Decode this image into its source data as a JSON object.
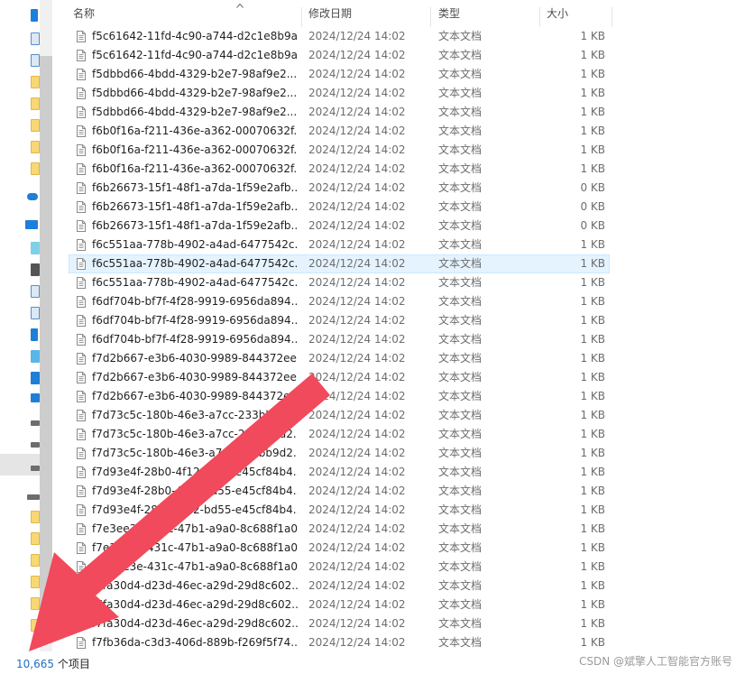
{
  "columns": {
    "name": "名称",
    "date": "修改日期",
    "type": "类型",
    "size": "大小"
  },
  "files": [
    {
      "name": "f5c61642-11fd-4c90-a744-d2c1e8b9a...",
      "date": "2024/12/24 14:02",
      "type": "文本文档",
      "size": "1 KB"
    },
    {
      "name": "f5c61642-11fd-4c90-a744-d2c1e8b9a...",
      "date": "2024/12/24 14:02",
      "type": "文本文档",
      "size": "1 KB"
    },
    {
      "name": "f5dbbd66-4bdd-4329-b2e7-98af9e2...",
      "date": "2024/12/24 14:02",
      "type": "文本文档",
      "size": "1 KB"
    },
    {
      "name": "f5dbbd66-4bdd-4329-b2e7-98af9e2...",
      "date": "2024/12/24 14:02",
      "type": "文本文档",
      "size": "1 KB"
    },
    {
      "name": "f5dbbd66-4bdd-4329-b2e7-98af9e2...",
      "date": "2024/12/24 14:02",
      "type": "文本文档",
      "size": "1 KB"
    },
    {
      "name": "f6b0f16a-f211-436e-a362-00070632f...",
      "date": "2024/12/24 14:02",
      "type": "文本文档",
      "size": "1 KB"
    },
    {
      "name": "f6b0f16a-f211-436e-a362-00070632f...",
      "date": "2024/12/24 14:02",
      "type": "文本文档",
      "size": "1 KB"
    },
    {
      "name": "f6b0f16a-f211-436e-a362-00070632f...",
      "date": "2024/12/24 14:02",
      "type": "文本文档",
      "size": "1 KB"
    },
    {
      "name": "f6b26673-15f1-48f1-a7da-1f59e2afb...",
      "date": "2024/12/24 14:02",
      "type": "文本文档",
      "size": "0 KB"
    },
    {
      "name": "f6b26673-15f1-48f1-a7da-1f59e2afb...",
      "date": "2024/12/24 14:02",
      "type": "文本文档",
      "size": "0 KB"
    },
    {
      "name": "f6b26673-15f1-48f1-a7da-1f59e2afb...",
      "date": "2024/12/24 14:02",
      "type": "文本文档",
      "size": "0 KB"
    },
    {
      "name": "f6c551aa-778b-4902-a4ad-6477542c...",
      "date": "2024/12/24 14:02",
      "type": "文本文档",
      "size": "1 KB"
    },
    {
      "name": "f6c551aa-778b-4902-a4ad-6477542c...",
      "date": "2024/12/24 14:02",
      "type": "文本文档",
      "size": "1 KB",
      "selected": true
    },
    {
      "name": "f6c551aa-778b-4902-a4ad-6477542c...",
      "date": "2024/12/24 14:02",
      "type": "文本文档",
      "size": "1 KB"
    },
    {
      "name": "f6df704b-bf7f-4f28-9919-6956da894...",
      "date": "2024/12/24 14:02",
      "type": "文本文档",
      "size": "1 KB"
    },
    {
      "name": "f6df704b-bf7f-4f28-9919-6956da894...",
      "date": "2024/12/24 14:02",
      "type": "文本文档",
      "size": "1 KB"
    },
    {
      "name": "f6df704b-bf7f-4f28-9919-6956da894...",
      "date": "2024/12/24 14:02",
      "type": "文本文档",
      "size": "1 KB"
    },
    {
      "name": "f7d2b667-e3b6-4030-9989-844372ee...",
      "date": "2024/12/24 14:02",
      "type": "文本文档",
      "size": "1 KB"
    },
    {
      "name": "f7d2b667-e3b6-4030-9989-844372ee...",
      "date": "2024/12/24 14:02",
      "type": "文本文档",
      "size": "1 KB"
    },
    {
      "name": "f7d2b667-e3b6-4030-9989-844372ee...",
      "date": "2024/12/24 14:02",
      "type": "文本文档",
      "size": "1 KB"
    },
    {
      "name": "f7d73c5c-180b-46e3-a7cc-233bb9d2...",
      "date": "2024/12/24 14:02",
      "type": "文本文档",
      "size": "1 KB"
    },
    {
      "name": "f7d73c5c-180b-46e3-a7cc-233bb9d2...",
      "date": "2024/12/24 14:02",
      "type": "文本文档",
      "size": "1 KB"
    },
    {
      "name": "f7d73c5c-180b-46e3-a7cc-233bb9d2...",
      "date": "2024/12/24 14:02",
      "type": "文本文档",
      "size": "1 KB"
    },
    {
      "name": "f7d93e4f-28b0-4f12-bd55-e45cf84b4...",
      "date": "2024/12/24 14:02",
      "type": "文本文档",
      "size": "1 KB"
    },
    {
      "name": "f7d93e4f-28b0-4f12-bd55-e45cf84b4...",
      "date": "2024/12/24 14:02",
      "type": "文本文档",
      "size": "1 KB"
    },
    {
      "name": "f7d93e4f-28b0-4f12-bd55-e45cf84b4...",
      "date": "2024/12/24 14:02",
      "type": "文本文档",
      "size": "1 KB"
    },
    {
      "name": "f7e3ee3e-431c-47b1-a9a0-8c688f1a0...",
      "date": "2024/12/24 14:02",
      "type": "文本文档",
      "size": "1 KB"
    },
    {
      "name": "f7e3ee3e-431c-47b1-a9a0-8c688f1a0...",
      "date": "2024/12/24 14:02",
      "type": "文本文档",
      "size": "1 KB"
    },
    {
      "name": "f7e3ee3e-431c-47b1-a9a0-8c688f1a0...",
      "date": "2024/12/24 14:02",
      "type": "文本文档",
      "size": "1 KB"
    },
    {
      "name": "f7fa30d4-d23d-46ec-a29d-29d8c602...",
      "date": "2024/12/24 14:02",
      "type": "文本文档",
      "size": "1 KB"
    },
    {
      "name": "f7fa30d4-d23d-46ec-a29d-29d8c602...",
      "date": "2024/12/24 14:02",
      "type": "文本文档",
      "size": "1 KB"
    },
    {
      "name": "f7fa30d4-d23d-46ec-a29d-29d8c602...",
      "date": "2024/12/24 14:02",
      "type": "文本文档",
      "size": "1 KB"
    },
    {
      "name": "f7fb36da-c3d3-406d-889b-f269f5f74...",
      "date": "2024/12/24 14:02",
      "type": "文本文档",
      "size": "1 KB"
    }
  ],
  "status": {
    "count": "10,665",
    "suffix": " 个项目"
  },
  "watermark": "CSDN @斌擎人工智能官方账号",
  "colors": {
    "arrow": "#f04a5c",
    "selection": "#e5f3ff",
    "folder": "#f8d775",
    "accent": "#1e7fd6"
  }
}
